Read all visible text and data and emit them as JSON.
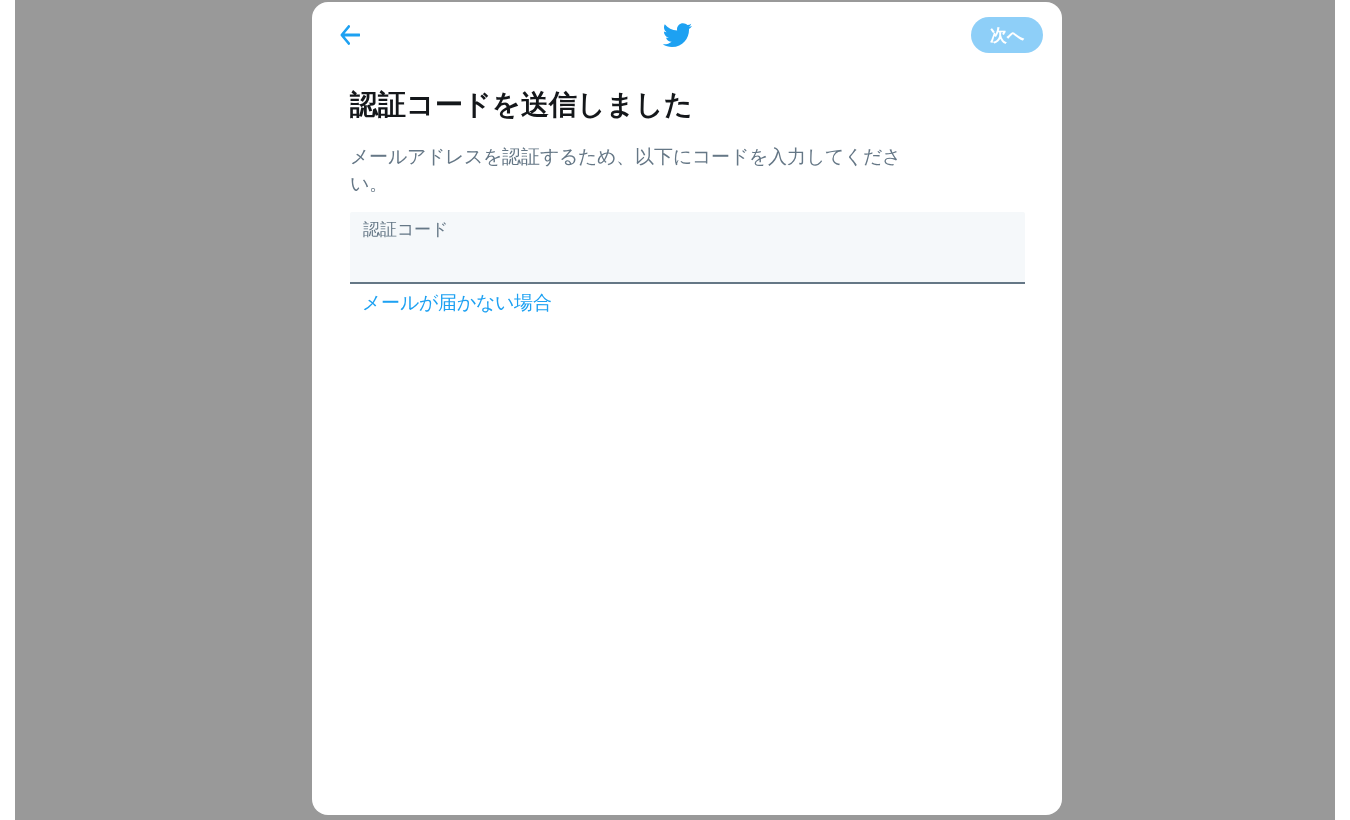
{
  "header": {
    "next_button": {
      "label": "次へ",
      "disabled": true
    }
  },
  "title": "認証コードを送信しました",
  "description": "メールアドレスを認証するため、以下にコードを入力してください。",
  "code_field": {
    "placeholder": "認証コード"
  },
  "help_link": "メールが届かない場合"
}
